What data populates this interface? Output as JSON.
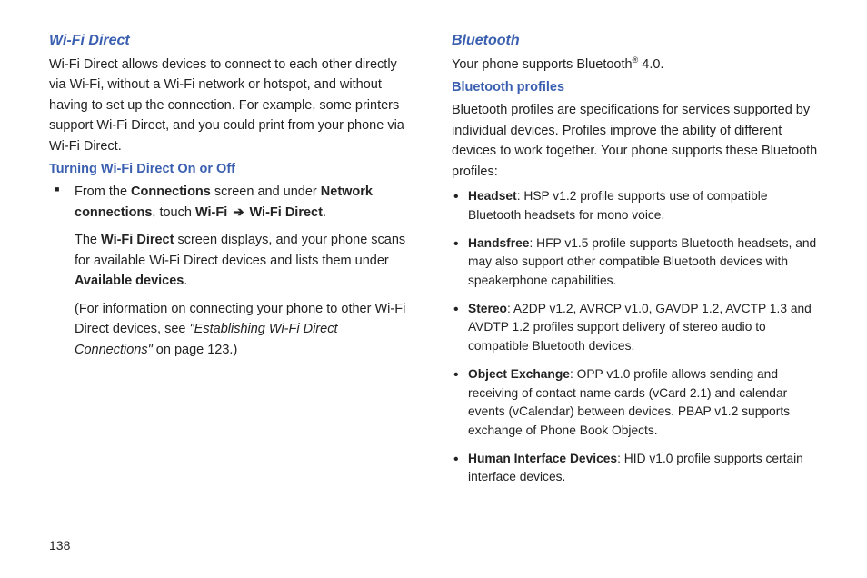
{
  "page_number": "138",
  "left": {
    "heading": "Wi-Fi Direct",
    "intro": "Wi-Fi Direct allows devices to connect to each other directly via Wi-Fi, without a Wi-Fi network or hotspot, and without having to set up the connection. For example, some printers support Wi-Fi Direct, and you could print from your phone via Wi-Fi Direct.",
    "subhead": "Turning Wi-Fi Direct On or Off",
    "step1_pre": "From the ",
    "step1_b1": "Connections",
    "step1_mid1": " screen and under ",
    "step1_b2": "Network connections",
    "step1_mid2": ", touch ",
    "step1_b3": "Wi-Fi",
    "step1_arrow": "➔",
    "step1_b4": "Wi-Fi Direct",
    "step1_post": ".",
    "step2_pre": "The ",
    "step2_b1": "Wi-Fi Direct",
    "step2_mid": " screen displays, and your phone scans for available Wi-Fi Direct devices and lists them under ",
    "step2_b2": "Available devices",
    "step2_post": ".",
    "step3_pre": "(For information on connecting your phone to other Wi-Fi Direct devices, see ",
    "step3_italic": "\"Establishing Wi-Fi Direct Connections\"",
    "step3_post": " on page 123.)"
  },
  "right": {
    "heading": "Bluetooth",
    "intro_pre": "Your phone supports Bluetooth",
    "intro_sup": "®",
    "intro_post": " 4.0.",
    "subhead": "Bluetooth profiles",
    "profiles_intro": "Bluetooth profiles are specifications for services supported by individual devices. Profiles improve the ability of different devices to work together. Your phone supports these Bluetooth profiles:",
    "items": [
      {
        "label": "Headset",
        "text": ": HSP v1.2 profile supports use of compatible Bluetooth headsets for mono voice."
      },
      {
        "label": "Handsfree",
        "text": ": HFP v1.5 profile supports Bluetooth headsets, and may also support other compatible Bluetooth devices with speakerphone capabilities."
      },
      {
        "label": "Stereo",
        "text": ": A2DP v1.2, AVRCP v1.0, GAVDP 1.2, AVCTP 1.3 and AVDTP 1.2 profiles support delivery of stereo audio to compatible Bluetooth devices."
      },
      {
        "label": "Object Exchange",
        "text": ": OPP v1.0 profile allows sending and receiving of contact name cards (vCard 2.1) and calendar events (vCalendar) between devices. PBAP v1.2 supports exchange of Phone Book Objects."
      },
      {
        "label": "Human Interface Devices",
        "text": ": HID v1.0 profile supports certain interface devices."
      }
    ]
  }
}
